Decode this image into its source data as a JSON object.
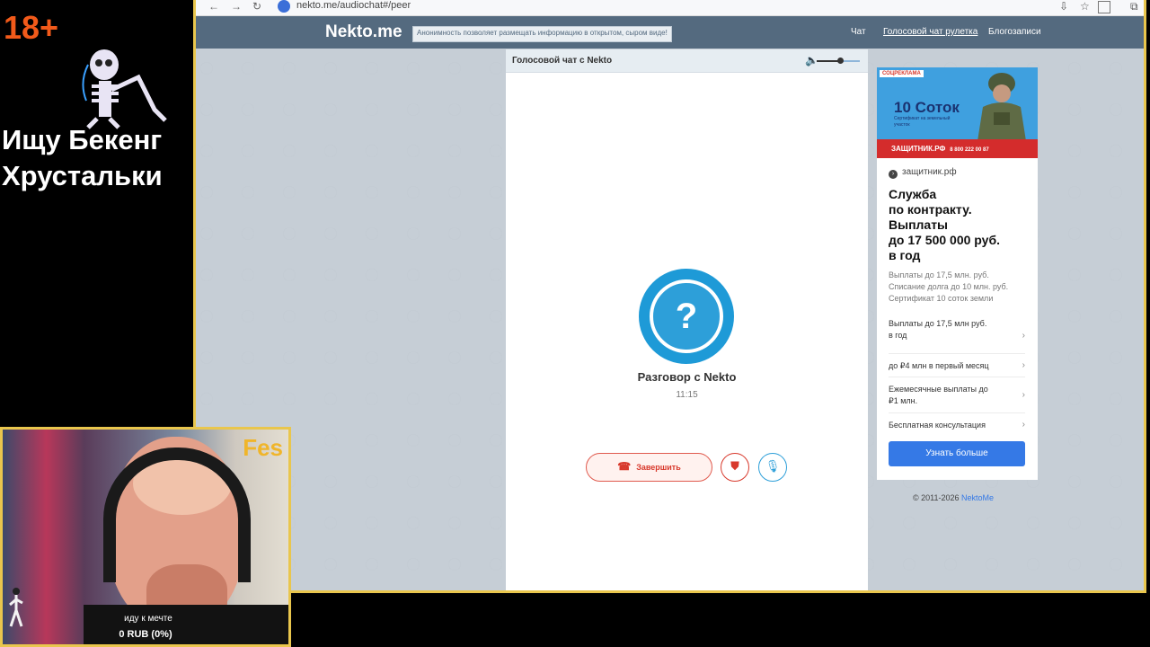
{
  "overlay": {
    "age": "18+",
    "title_line1": "Ищу Бекенг",
    "title_line2": "Хрустальки",
    "cam_name": "Fes",
    "cam_caption": "иду к мечте",
    "donate_status": "0 RUB (0%)"
  },
  "browser": {
    "url": "nekto.me/audiochat#/peer",
    "back_icon": "arrow-left-icon",
    "forward_icon": "arrow-right-icon",
    "reload_icon": "reload-icon"
  },
  "site": {
    "logo": "Nekto.me",
    "notice": "Анонимность позволяет размещать информацию в открытом, сыром виде!",
    "menu": [
      "Чат",
      "Голосовой чат рулетка",
      "Блогозаписи"
    ],
    "footer_text": "© 2011-2026",
    "footer_link": "NektoMe"
  },
  "chat": {
    "panel_title": "Голосовой чат с Nekto",
    "volume_icon": "speaker-icon",
    "volume_level": 0.6,
    "avatar_symbol": "?",
    "talk_title": "Разговор с Nekto",
    "talk_time": "11:15",
    "end_label": "Завершить",
    "end_icon": "hangup-icon",
    "report_icon": "shield-alert-icon",
    "mic_icon": "microphone-icon",
    "accent": "#2d9fd9",
    "danger": "#d8392c"
  },
  "ad": {
    "tag": "СОЦРЕКЛАМА",
    "headline": "10 Соток",
    "sub": "Сертификат на земельный участок",
    "strip_brand": "ЗАЩИТНИК.РФ",
    "strip_phone": "8 800 222 00 87",
    "domain": "защитник.рф",
    "title": "Служба\nпо контракту.\nВыплаты\nдо 17 500 000 руб.\nв год",
    "desc": "Выплаты до 17,5 млн. руб.\nСписание долга до 10 млн. руб.\nСертификат 10 соток земли",
    "items": [
      "Выплаты до 17,5 млн руб.\nв год",
      "до ₽4 млн в первый месяц",
      "Ежемесячные выплаты до\n₽1 млн.",
      "Бесплатная консультация"
    ],
    "cta": "Узнать больше"
  }
}
